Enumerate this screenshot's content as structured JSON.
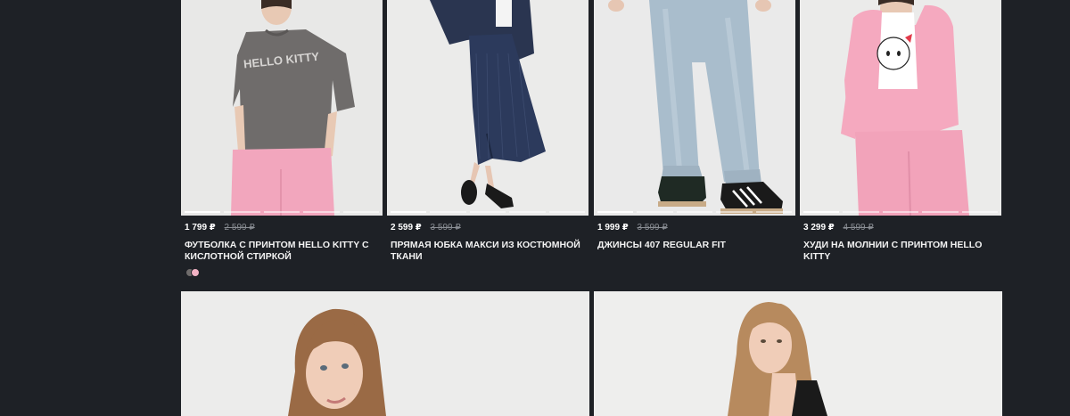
{
  "products": [
    {
      "price": "1 799 ₽",
      "old_price": "2 599 ₽",
      "title": "Футболка с принтом Hello Kitty с кислотной стиркой",
      "print_text": "HELLO KITTY",
      "swatches": [
        "#6f6c6b",
        "#f2b2c4"
      ]
    },
    {
      "price": "2 599 ₽",
      "old_price": "3 599 ₽",
      "title": "Прямая юбка макси из костюмной ткани"
    },
    {
      "price": "1 999 ₽",
      "old_price": "3 599 ₽",
      "title": "Джинсы 407 Regular Fit"
    },
    {
      "price": "3 299 ₽",
      "old_price": "4 599 ₽",
      "title": "Худи на молнии с принтом Hello Kitty"
    }
  ],
  "colors": {
    "background": "#1e2126",
    "photo_bg": "#e9e9e8",
    "old_price": "#8a8e94"
  }
}
